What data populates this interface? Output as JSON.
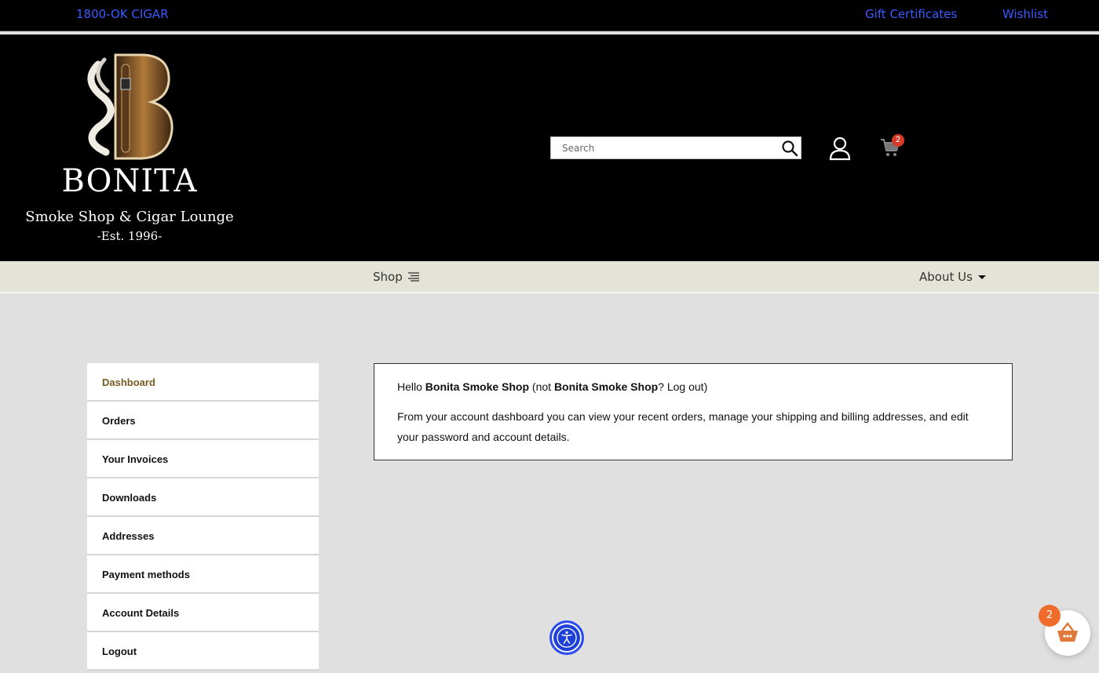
{
  "topbar": {
    "phone": "1800-OK CIGAR",
    "gift_certificates": "Gift Certificates",
    "wishlist": "Wishlist"
  },
  "logo": {
    "name": "BONITA",
    "subtitle": "Smoke Shop & Cigar Lounge",
    "established": "-Est. 1996-"
  },
  "search": {
    "placeholder": "Search"
  },
  "cart": {
    "count": "2"
  },
  "nav": {
    "shop": "Shop",
    "about": "About Us"
  },
  "sidebar": {
    "items": [
      {
        "label": "Dashboard",
        "active": true
      },
      {
        "label": "Orders"
      },
      {
        "label": "Your Invoices"
      },
      {
        "label": "Downloads"
      },
      {
        "label": "Addresses"
      },
      {
        "label": "Payment methods"
      },
      {
        "label": "Account Details"
      },
      {
        "label": "Logout"
      }
    ]
  },
  "dashboard": {
    "hello_prefix": "Hello ",
    "user_name": "Bonita Smoke Shop",
    "not_prefix": " (not ",
    "not_user": "Bonita Smoke Shop",
    "logout_text": "? Log out",
    "close_paren": ")",
    "description": "From your account dashboard you can view your recent orders, manage your shipping and billing addresses, and edit your password and account details."
  },
  "basket": {
    "count": "2"
  },
  "colors": {
    "link_blue": "#3b5bff",
    "active_brown": "#7a5a1e",
    "badge_red": "#d63a2b",
    "basket_orange": "#ef6c2a",
    "a11y_blue": "#1f3fd9"
  }
}
